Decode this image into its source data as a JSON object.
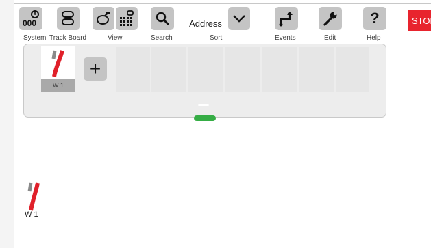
{
  "toolbar": {
    "system_label": "System",
    "trackboard_label": "Track Board",
    "view_label": "View",
    "search_label": "Search",
    "address_value": "Address",
    "sort_label": "Sort",
    "events_label": "Events",
    "edit_label": "Edit",
    "help_label": "Help",
    "stop_label": "STOP",
    "help_glyph": "?"
  },
  "panel": {
    "items": [
      {
        "label": "W 1",
        "icon": "turnout-left-icon"
      }
    ],
    "add_glyph": "+"
  },
  "layout": {
    "items": [
      {
        "label": "W 1",
        "icon": "turnout-left-icon"
      }
    ]
  },
  "colors": {
    "tool_bg": "#c4c4c4",
    "stop_red": "#e8242e",
    "handle_green": "#35ad45",
    "turnout_red": "#e0202a",
    "turnout_gray": "#8a8a8a"
  }
}
